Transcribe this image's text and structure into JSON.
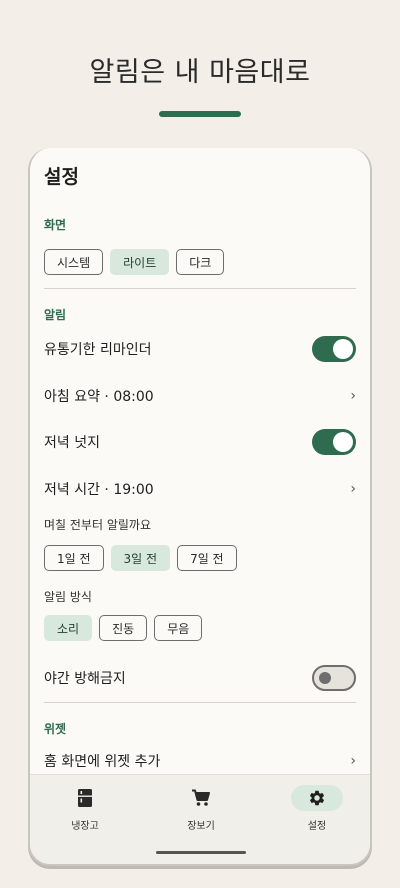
{
  "hero": {
    "title": "알림은 내 마음대로"
  },
  "settings": {
    "title": "설정",
    "screen": {
      "label": "화면",
      "options": [
        "시스템",
        "라이트",
        "다크"
      ],
      "selected": "라이트"
    },
    "alerts": {
      "label": "알림",
      "expiry_reminder": {
        "label": "유통기한 리마인더",
        "on": true
      },
      "morning_summary": {
        "label": "아침 요약 · 08:00"
      },
      "evening_nudge": {
        "label": "저녁 넛지",
        "on": true
      },
      "evening_time": {
        "label": "저녁 시간 · 19:00"
      },
      "days_before": {
        "label": "며칠 전부터 알릴까요",
        "options": [
          "1일 전",
          "3일 전",
          "7일 전"
        ],
        "selected": "3일 전"
      },
      "method": {
        "label": "알림 방식",
        "options": [
          "소리",
          "진동",
          "무음"
        ],
        "selected": "소리"
      },
      "dnd": {
        "label": "야간 방해금지",
        "on": false
      }
    },
    "widget": {
      "label": "위젯",
      "add_home": {
        "label": "홈 화면에 위젯 추가"
      }
    }
  },
  "nav": {
    "items": [
      {
        "label": "냉장고",
        "icon": "fridge-icon",
        "active": false
      },
      {
        "label": "장보기",
        "icon": "cart-icon",
        "active": false
      },
      {
        "label": "설정",
        "icon": "gear-icon",
        "active": true
      }
    ]
  },
  "chevron": "›",
  "colors": {
    "accent": "#2f6b4f",
    "chip_selected": "#d8e8dc",
    "background": "#f3efe8"
  }
}
